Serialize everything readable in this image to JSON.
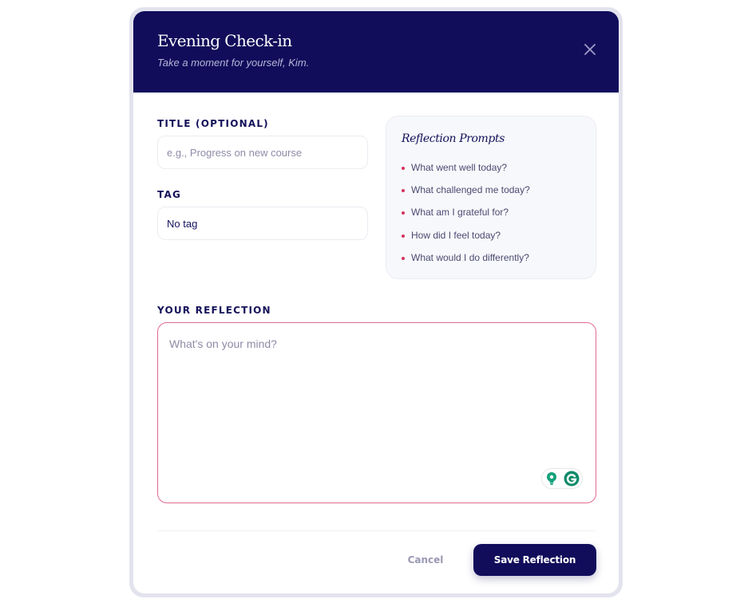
{
  "header": {
    "title": "Evening Check-in",
    "subtitle": "Take a moment for yourself, Kim."
  },
  "close_icon": "close-icon",
  "form": {
    "title_label": "TITLE (OPTIONAL)",
    "title_value": "",
    "title_placeholder": "e.g., Progress on new course",
    "tag_label": "TAG",
    "tag_value": "No tag",
    "reflection_label": "YOUR REFLECTION",
    "reflection_value": "",
    "reflection_placeholder": "What's on your mind?"
  },
  "prompts": {
    "title": "Reflection Prompts",
    "items": [
      "What went well today?",
      "What challenged me today?",
      "What am I grateful for?",
      "How did I feel today?",
      "What would I do differently?"
    ]
  },
  "actions": {
    "cancel_label": "Cancel",
    "save_label": "Save Reflection"
  },
  "colors": {
    "header_bg": "#110d5b",
    "accent": "#d6335e",
    "textarea_border": "#e36a8c",
    "grammarly_green": "#15a17a"
  }
}
